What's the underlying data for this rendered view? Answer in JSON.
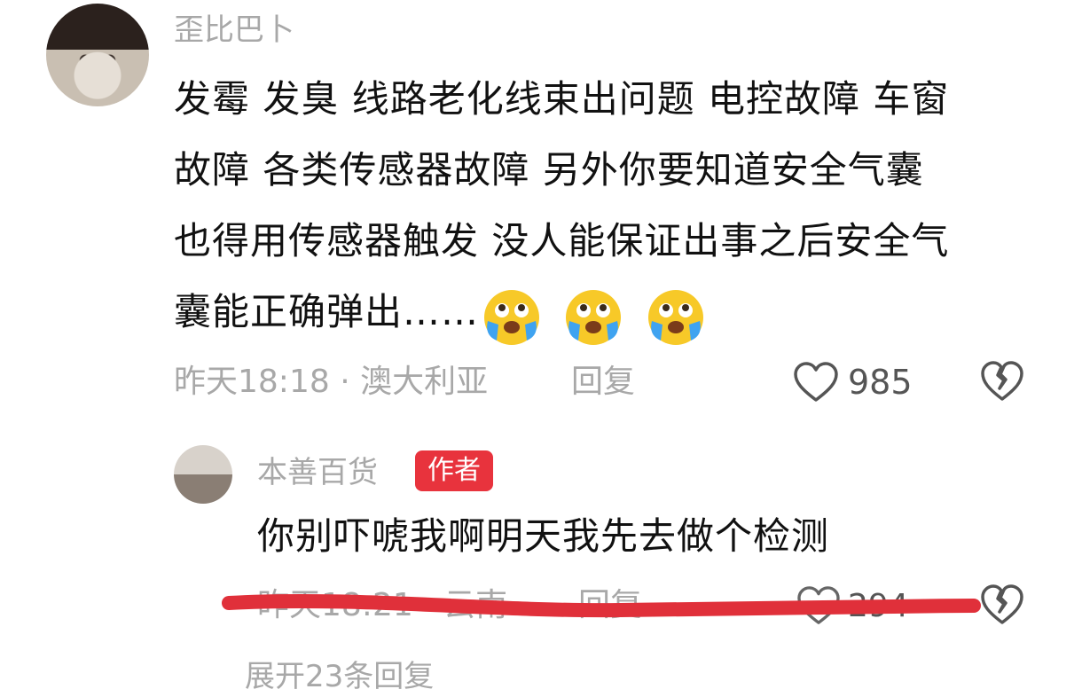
{
  "comment": {
    "username": "歪比巴卜",
    "content_lines": [
      "发霉 发臭 线路老化线束出问题 电控故障 车窗",
      "故障 各类传感器故障 另外你要知道安全气囊",
      "也得用传感器触发 没人能保证出事之后安全气",
      "囊能正确弹出……"
    ],
    "emojis": [
      "crying-emoji",
      "crying-emoji",
      "crying-emoji"
    ],
    "meta": "昨天18:18 · 澳大利亚",
    "reply_label": "回复",
    "like_count": "985"
  },
  "reply": {
    "username": "本善百货",
    "badge": "作者",
    "content": "你别吓唬我啊明天我先去做个检测",
    "meta": "昨天18:21 · 云南",
    "reply_label": "回复",
    "like_count": "294"
  },
  "expand_label": "展开23条回复",
  "colors": {
    "muted_text": "#a8a8a8",
    "badge_red": "#e8333d",
    "strike_red": "#e0303a"
  }
}
